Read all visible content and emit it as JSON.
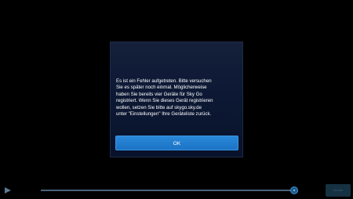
{
  "dialog": {
    "message": "Es ist ein Fehler aufgetreten. Bitte versuchen\nSie es später noch einmal. Möglicherweise\nhaben Sie bereits vier Geräte für Sky Go\nregistriert. Wenn Sie dieses Gerät registrieren\nwollen, setzen Sie bitte auf skygo.sky.de\nunter \"Einstellungen\" Ihre Geräteliste zurück.",
    "ok_label": "OK"
  },
  "player": {
    "play_icon": "play-icon",
    "progress_fraction": 0.99,
    "corner_button_label": "Sender"
  },
  "colors": {
    "accent": "#1c73c6",
    "dialog_background": "#0e1a36",
    "screen_background": "#000000"
  }
}
